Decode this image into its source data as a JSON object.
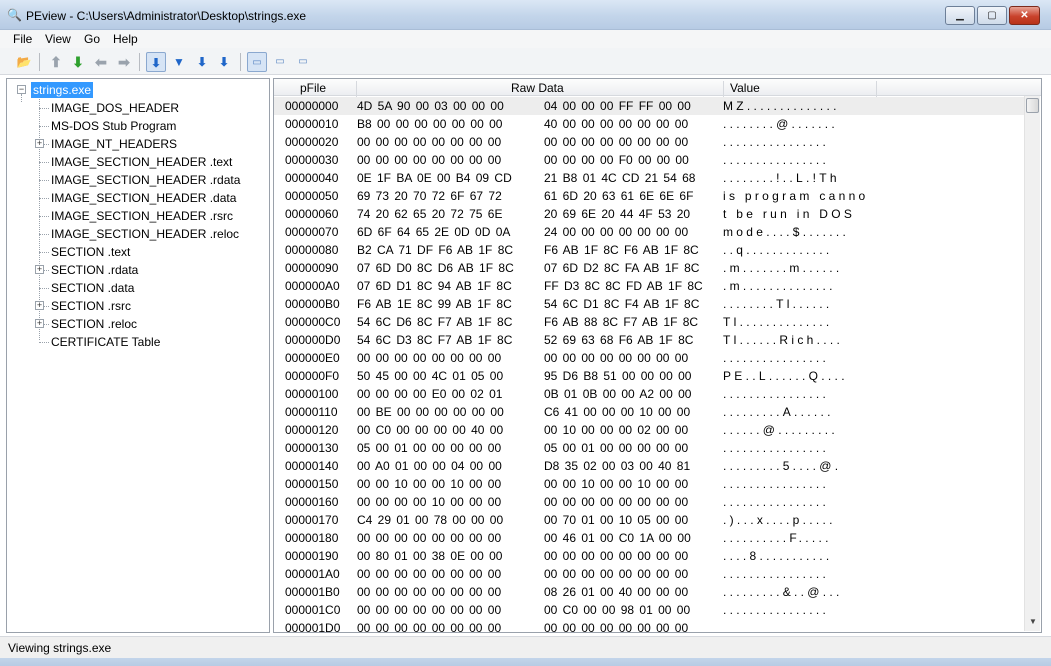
{
  "window": {
    "title": "PEview - C:\\Users\\Administrator\\Desktop\\strings.exe",
    "min": "▁",
    "max": "▢",
    "close": "✕"
  },
  "menu": [
    "File",
    "View",
    "Go",
    "Help"
  ],
  "toolbar": [
    {
      "name": "open-icon",
      "glyph": "📂"
    },
    {
      "name": "up-icon",
      "glyph": "⬆"
    },
    {
      "name": "down-icon",
      "glyph": "⬇"
    },
    {
      "name": "back-icon",
      "glyph": "⬅"
    },
    {
      "name": "forward-icon",
      "glyph": "➡"
    },
    {
      "name": "view-hex-icon",
      "glyph": "⬇"
    },
    {
      "name": "view-struct-icon",
      "glyph": "▼"
    },
    {
      "name": "view-dword-icon",
      "glyph": "⬇"
    },
    {
      "name": "view-word-icon",
      "glyph": "⬇"
    },
    {
      "name": "byte-view-icon",
      "glyph": "▭"
    },
    {
      "name": "word-view-icon",
      "glyph": "▭"
    },
    {
      "name": "dword-view-icon",
      "glyph": "▭"
    }
  ],
  "tree": {
    "root": "strings.exe",
    "items": [
      {
        "label": "IMAGE_DOS_HEADER",
        "expandable": false
      },
      {
        "label": "MS-DOS Stub Program",
        "expandable": false
      },
      {
        "label": "IMAGE_NT_HEADERS",
        "expandable": true
      },
      {
        "label": "IMAGE_SECTION_HEADER .text",
        "expandable": false
      },
      {
        "label": "IMAGE_SECTION_HEADER .rdata",
        "expandable": false
      },
      {
        "label": "IMAGE_SECTION_HEADER .data",
        "expandable": false
      },
      {
        "label": "IMAGE_SECTION_HEADER .rsrc",
        "expandable": false
      },
      {
        "label": "IMAGE_SECTION_HEADER .reloc",
        "expandable": false
      },
      {
        "label": "SECTION .text",
        "expandable": false
      },
      {
        "label": "SECTION .rdata",
        "expandable": true
      },
      {
        "label": "SECTION .data",
        "expandable": false
      },
      {
        "label": "SECTION .rsrc",
        "expandable": true
      },
      {
        "label": "SECTION .reloc",
        "expandable": true
      },
      {
        "label": "CERTIFICATE Table",
        "expandable": false
      }
    ]
  },
  "hex": {
    "headers": {
      "pfile": "pFile",
      "raw": "Raw Data",
      "value": "Value"
    },
    "rows": [
      {
        "off": "00000000",
        "b1": "4D 5A 90 00 03 00 00 00",
        "b2": "04 00 00 00 FF FF 00 00",
        "val": "MZ.............."
      },
      {
        "off": "00000010",
        "b1": "B8 00 00 00 00 00 00 00",
        "b2": "40 00 00 00 00 00 00 00",
        "val": "........@......."
      },
      {
        "off": "00000020",
        "b1": "00 00 00 00 00 00 00 00",
        "b2": "00 00 00 00 00 00 00 00",
        "val": "................"
      },
      {
        "off": "00000030",
        "b1": "00 00 00 00 00 00 00 00",
        "b2": "00 00 00 00 F0 00 00 00",
        "val": "................"
      },
      {
        "off": "00000040",
        "b1": "0E 1F BA 0E 00 B4 09 CD",
        "b2": "21 B8 01 4C CD 21 54 68",
        "val": "........!..L.!Th"
      },
      {
        "off": "00000050",
        "b1": "69 73 20 70 72 6F 67 72",
        "b2": "61 6D 20 63 61 6E 6E 6F",
        "val": "is program canno"
      },
      {
        "off": "00000060",
        "b1": "74 20 62 65 20 72 75 6E",
        "b2": "20 69 6E 20 44 4F 53 20",
        "val": "t be run in DOS "
      },
      {
        "off": "00000070",
        "b1": "6D 6F 64 65 2E 0D 0D 0A",
        "b2": "24 00 00 00 00 00 00 00",
        "val": "mode....$......."
      },
      {
        "off": "00000080",
        "b1": "B2 CA 71 DF F6 AB 1F 8C",
        "b2": "F6 AB 1F 8C F6 AB 1F 8C",
        "val": "..q............."
      },
      {
        "off": "00000090",
        "b1": "07 6D D0 8C D6 AB 1F 8C",
        "b2": "07 6D D2 8C FA AB 1F 8C",
        "val": ".m.......m......"
      },
      {
        "off": "000000A0",
        "b1": "07 6D D1 8C 94 AB 1F 8C",
        "b2": "FF D3 8C 8C FD AB 1F 8C",
        "val": ".m.............."
      },
      {
        "off": "000000B0",
        "b1": "F6 AB 1E 8C 99 AB 1F 8C",
        "b2": "54 6C D1 8C F4 AB 1F 8C",
        "val": "........Tl......"
      },
      {
        "off": "000000C0",
        "b1": "54 6C D6 8C F7 AB 1F 8C",
        "b2": "F6 AB 88 8C F7 AB 1F 8C",
        "val": "Tl.............."
      },
      {
        "off": "000000D0",
        "b1": "54 6C D3 8C F7 AB 1F 8C",
        "b2": "52 69 63 68 F6 AB 1F 8C",
        "val": "Tl......Rich...."
      },
      {
        "off": "000000E0",
        "b1": "00 00 00 00 00 00 00 00",
        "b2": "00 00 00 00 00 00 00 00",
        "val": "................"
      },
      {
        "off": "000000F0",
        "b1": "50 45 00 00 4C 01 05 00",
        "b2": "95 D6 B8 51 00 00 00 00",
        "val": "PE..L......Q...."
      },
      {
        "off": "00000100",
        "b1": "00 00 00 00 E0 00 02 01",
        "b2": "0B 01 0B 00 00 A2 00 00",
        "val": "................"
      },
      {
        "off": "00000110",
        "b1": "00 BE 00 00 00 00 00 00",
        "b2": "C6 41 00 00 00 10 00 00",
        "val": ".........A......"
      },
      {
        "off": "00000120",
        "b1": "00 C0 00 00 00 00 40 00",
        "b2": "00 10 00 00 00 02 00 00",
        "val": "......@........."
      },
      {
        "off": "00000130",
        "b1": "05 00 01 00 00 00 00 00",
        "b2": "05 00 01 00 00 00 00 00",
        "val": "................"
      },
      {
        "off": "00000140",
        "b1": "00 A0 01 00 00 04 00 00",
        "b2": "D8 35 02 00 03 00 40 81",
        "val": ".........5....@."
      },
      {
        "off": "00000150",
        "b1": "00 00 10 00 00 10 00 00",
        "b2": "00 00 10 00 00 10 00 00",
        "val": "................"
      },
      {
        "off": "00000160",
        "b1": "00 00 00 00 10 00 00 00",
        "b2": "00 00 00 00 00 00 00 00",
        "val": "................"
      },
      {
        "off": "00000170",
        "b1": "C4 29 01 00 78 00 00 00",
        "b2": "00 70 01 00 10 05 00 00",
        "val": ".)...x....p....."
      },
      {
        "off": "00000180",
        "b1": "00 00 00 00 00 00 00 00",
        "b2": "00 46 01 00 C0 1A 00 00",
        "val": "..........F....."
      },
      {
        "off": "00000190",
        "b1": "00 80 01 00 38 0E 00 00",
        "b2": "00 00 00 00 00 00 00 00",
        "val": "....8..........."
      },
      {
        "off": "000001A0",
        "b1": "00 00 00 00 00 00 00 00",
        "b2": "00 00 00 00 00 00 00 00",
        "val": "................"
      },
      {
        "off": "000001B0",
        "b1": "00 00 00 00 00 00 00 00",
        "b2": "08 26 01 00 40 00 00 00",
        "val": ".........&..@..."
      },
      {
        "off": "000001C0",
        "b1": "00 00 00 00 00 00 00 00",
        "b2": "00 C0 00 00 98 01 00 00",
        "val": "................"
      },
      {
        "off": "000001D0",
        "b1": "00 00 00 00 00 00 00 00",
        "b2": "00 00 00 00 00 00 00 00",
        "val": ""
      }
    ]
  },
  "scroll": {
    "up": "▲",
    "down": "▼"
  },
  "status": "Viewing strings.exe",
  "colors": {
    "selection": "#3399ff",
    "highlightRow": "#ededed"
  }
}
